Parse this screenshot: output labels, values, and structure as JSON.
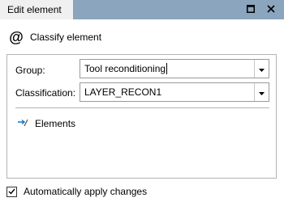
{
  "window": {
    "title": "Edit element",
    "maximize_icon": "maximize-icon",
    "close_icon": "close-icon"
  },
  "header": {
    "icon": "@",
    "label": "Classify element"
  },
  "form": {
    "group": {
      "label": "Group:",
      "value": "Tool reconditioning"
    },
    "classification": {
      "label": "Classification:",
      "value": "LAYER_RECON1"
    },
    "elements_link": "Elements"
  },
  "footer": {
    "auto_apply_label": "Automatically apply changes",
    "auto_apply_checked": true
  },
  "colors": {
    "titlebar": "#8aa5bd",
    "tab": "#f0f0f0",
    "arrow_accent": "#1e7bc8"
  }
}
